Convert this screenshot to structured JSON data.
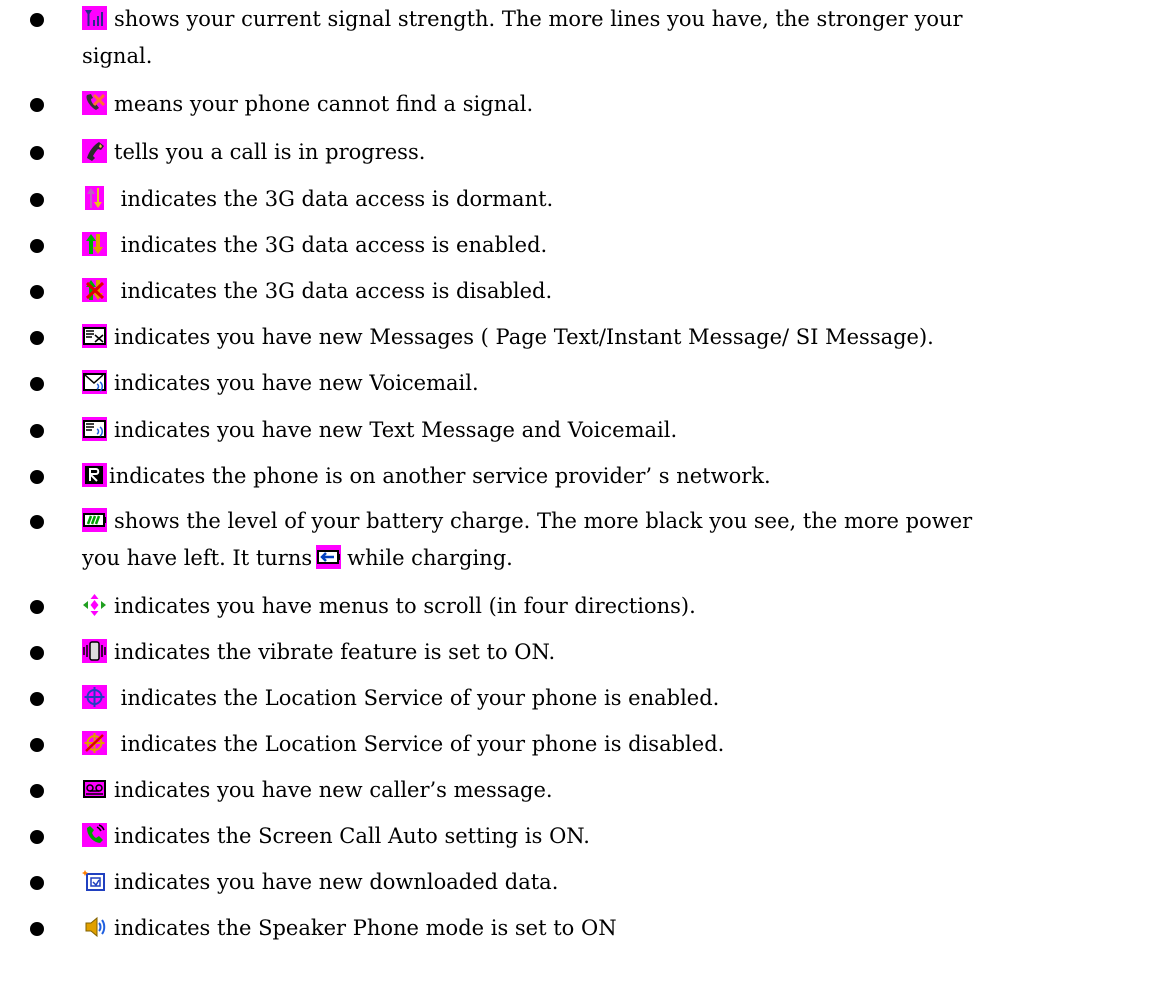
{
  "items": [
    {
      "icon": "signal-strength-icon",
      "text": "shows your current signal strength. The more lines you have, the stronger your",
      "text2": "signal."
    },
    {
      "icon": "no-signal-icon",
      "text": "means your phone cannot find a signal."
    },
    {
      "icon": "call-in-progress-icon",
      "text": "tells you a call is in progress."
    },
    {
      "icon": "3g-dormant-icon",
      "text": " indicates the 3G data access is dormant."
    },
    {
      "icon": "3g-enabled-icon",
      "text": " indicates the 3G data access is enabled."
    },
    {
      "icon": "3g-disabled-icon",
      "text": " indicates the 3G data access is disabled."
    },
    {
      "icon": "new-message-icon",
      "text": "indicates you have new Messages ( Page Text/Instant Message/ SI Message)."
    },
    {
      "icon": "new-voicemail-icon",
      "text": "indicates you have new Voicemail."
    },
    {
      "icon": "text-and-voicemail-icon",
      "text": "indicates you have new Text Message and Voicemail."
    },
    {
      "icon": "roaming-icon",
      "text": "indicates the phone is on another service provider’ s  network."
    },
    {
      "icon": "battery-icon",
      "text": "shows the level of your battery charge. The more black you see, the more power",
      "text2a": "you have left. It turns",
      "icon2": "charging-icon",
      "text2b": "while charging."
    },
    {
      "icon": "scroll-arrows-icon",
      "text": "indicates you have menus to scroll (in four directions)."
    },
    {
      "icon": "vibrate-icon",
      "text": "indicates the vibrate feature is set to ON."
    },
    {
      "icon": "location-on-icon",
      "text": " indicates the Location Service of your phone is enabled."
    },
    {
      "icon": "location-off-icon",
      "text": " indicates the Location Service of your phone is disabled."
    },
    {
      "icon": "caller-message-icon",
      "text": "indicates you have new caller’s message."
    },
    {
      "icon": "screen-call-icon",
      "text": "indicates the Screen Call Auto setting is ON."
    },
    {
      "icon": "download-icon",
      "text": "indicates you have new downloaded data."
    },
    {
      "icon": "speaker-phone-icon",
      "text": "indicates the Speaker Phone mode is set to ON"
    }
  ],
  "colors": {
    "icon_bg": "#ff00ff",
    "accent_green": "#00a000",
    "accent_blue": "#0040c0"
  }
}
